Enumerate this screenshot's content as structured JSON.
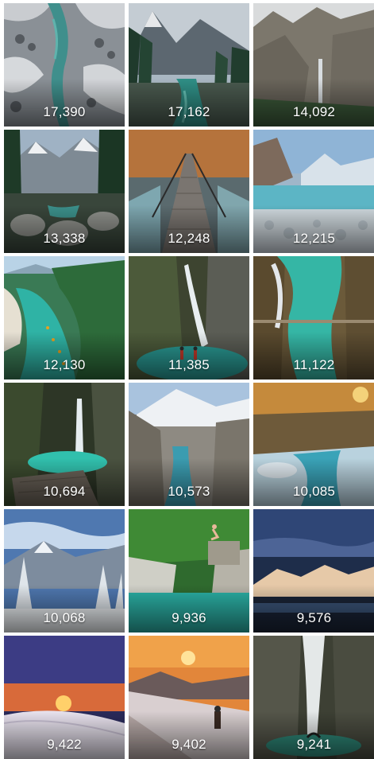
{
  "gallery": {
    "tiles": [
      {
        "count": "17,390",
        "scene": "snowy-river-gorge"
      },
      {
        "count": "17,162",
        "scene": "alpine-valley-river"
      },
      {
        "count": "14,092",
        "scene": "rock-cliff-waterfall"
      },
      {
        "count": "13,338",
        "scene": "mountain-forest-boulders"
      },
      {
        "count": "12,248",
        "scene": "suspension-bridge"
      },
      {
        "count": "12,215",
        "scene": "frosty-riverbank"
      },
      {
        "count": "12,130",
        "scene": "turquoise-river-kayaks"
      },
      {
        "count": "11,385",
        "scene": "waterfall-hikers"
      },
      {
        "count": "11,122",
        "scene": "emerald-gorge-bridge"
      },
      {
        "count": "10,694",
        "scene": "cave-waterfall-pool"
      },
      {
        "count": "10,573",
        "scene": "winter-valley-river"
      },
      {
        "count": "10,085",
        "scene": "icy-stream-sunset"
      },
      {
        "count": "10,068",
        "scene": "snowy-pine-mountains"
      },
      {
        "count": "9,936",
        "scene": "cliff-jumper-river"
      },
      {
        "count": "9,576",
        "scene": "mountain-range-dusk"
      },
      {
        "count": "9,422",
        "scene": "winter-sunset-hill"
      },
      {
        "count": "9,402",
        "scene": "mountaineer-sunset"
      },
      {
        "count": "9,241",
        "scene": "canyon-waterfall"
      }
    ]
  }
}
